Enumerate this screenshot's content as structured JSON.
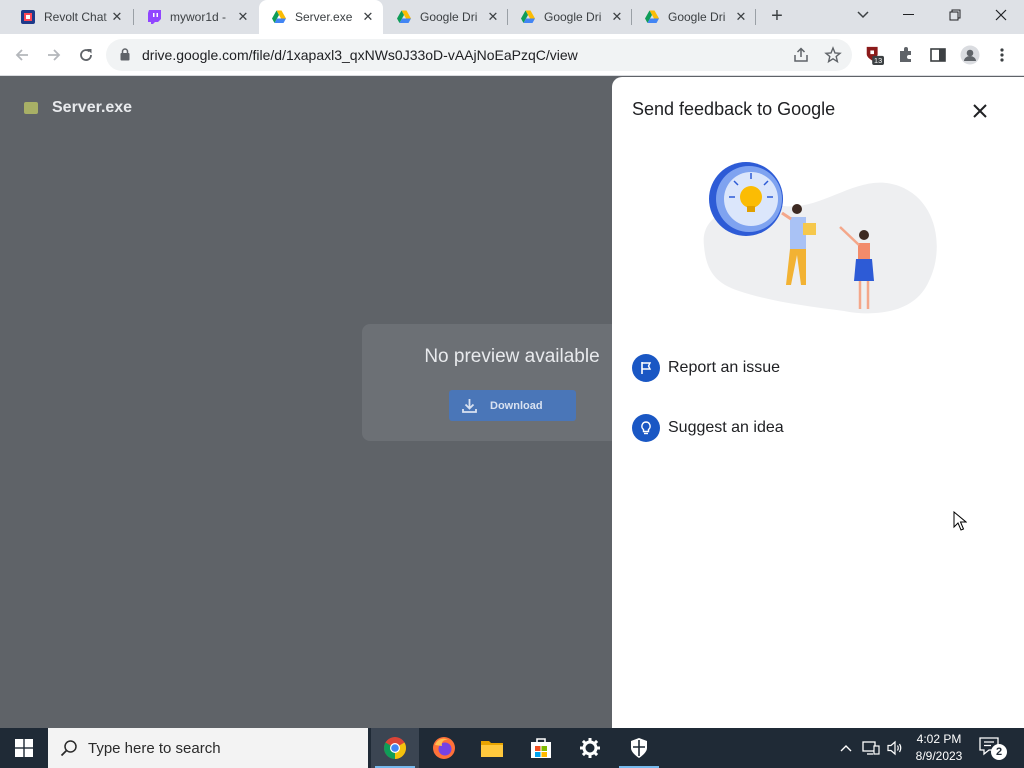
{
  "browser": {
    "tabs": [
      {
        "title": "Revolt Chat",
        "icon": "revolt-icon"
      },
      {
        "title": "mywor1d -",
        "icon": "twitch-icon"
      },
      {
        "title": "Server.exe",
        "icon": "google-drive-icon"
      },
      {
        "title": "Google Dri",
        "icon": "google-drive-icon"
      },
      {
        "title": "Google Dri",
        "icon": "google-drive-icon"
      },
      {
        "title": "Google Dri",
        "icon": "google-drive-icon"
      }
    ],
    "active_tab_index": 2,
    "url": "drive.google.com/file/d/1xapaxl3_qxNWs0J33oD-vAAjNoEaPzqC/view",
    "extension_badge": "13"
  },
  "drive": {
    "file_name": "Server.exe",
    "no_preview_text": "No preview available",
    "download_label": "Download"
  },
  "feedback": {
    "title": "Send feedback to Google",
    "options": [
      {
        "label": "Report an issue",
        "icon": "flag-icon"
      },
      {
        "label": "Suggest an idea",
        "icon": "lightbulb-icon"
      }
    ]
  },
  "taskbar": {
    "search_placeholder": "Type here to search",
    "apps": [
      "chrome-icon",
      "firefox-icon",
      "file-explorer-icon",
      "microsoft-store-icon",
      "settings-icon",
      "windows-security-icon"
    ],
    "time": "4:02 PM",
    "date": "8/9/2023",
    "notification_count": "2"
  },
  "colors": {
    "accent_blue": "#1a57c4",
    "overlay_gray": "#5f6368",
    "taskbar": "#1f2a36"
  }
}
